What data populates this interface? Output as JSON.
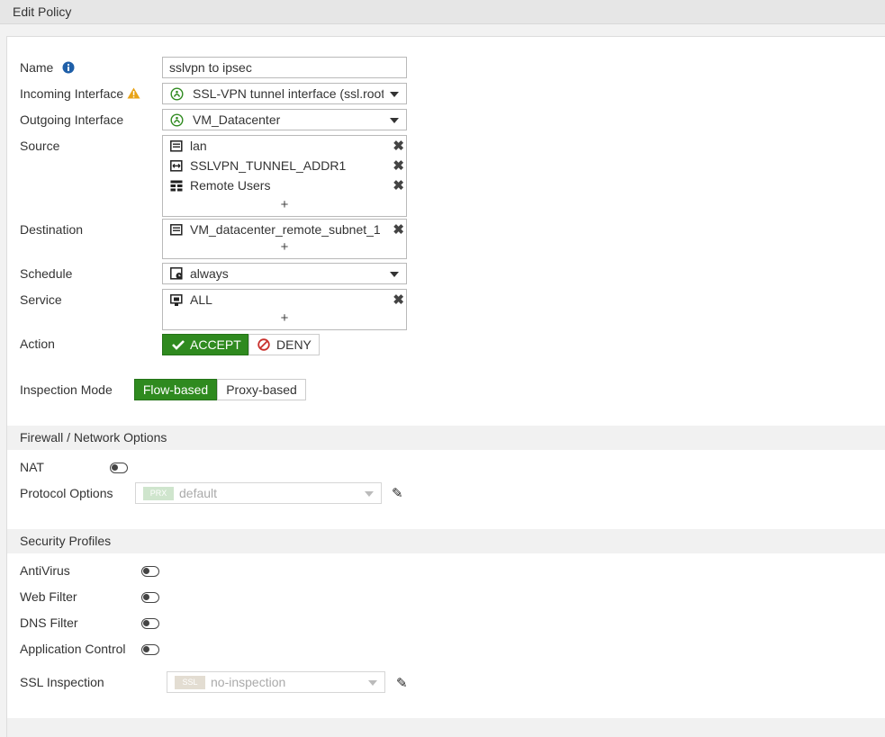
{
  "window": {
    "title": "Edit Policy"
  },
  "form": {
    "name": {
      "label": "Name",
      "value": "sslvpn to ipsec"
    },
    "incoming": {
      "label": "Incoming Interface",
      "value": "SSL-VPN tunnel interface (ssl.root)"
    },
    "outgoing": {
      "label": "Outgoing Interface",
      "value": "VM_Datacenter"
    },
    "source": {
      "label": "Source",
      "items": [
        "lan",
        "SSLVPN_TUNNEL_ADDR1",
        "Remote Users"
      ],
      "add": "+"
    },
    "destination": {
      "label": "Destination",
      "items": [
        "VM_datacenter_remote_subnet_1"
      ],
      "add": "+"
    },
    "schedule": {
      "label": "Schedule",
      "value": "always"
    },
    "service": {
      "label": "Service",
      "items": [
        "ALL"
      ],
      "add": "+"
    },
    "action": {
      "label": "Action",
      "accept": "ACCEPT",
      "deny": "DENY",
      "selected": "ACCEPT"
    },
    "inspection": {
      "label": "Inspection Mode",
      "flow": "Flow-based",
      "proxy": "Proxy-based",
      "selected": "Flow-based"
    }
  },
  "firewall": {
    "title": "Firewall / Network Options",
    "nat_label": "NAT",
    "protocol_label": "Protocol Options",
    "protocol_badge": "PRX",
    "protocol_value": "default"
  },
  "security": {
    "title": "Security Profiles",
    "antivirus": "AntiVirus",
    "webfilter": "Web Filter",
    "dnsfilter": "DNS Filter",
    "appcontrol": "Application Control",
    "ssl_label": "SSL Inspection",
    "ssl_badge": "SSL",
    "ssl_value": "no-inspection"
  },
  "colors": {
    "accent_green": "#2f8a1f",
    "warning": "#e8a317",
    "info_blue": "#1f5fa8"
  }
}
